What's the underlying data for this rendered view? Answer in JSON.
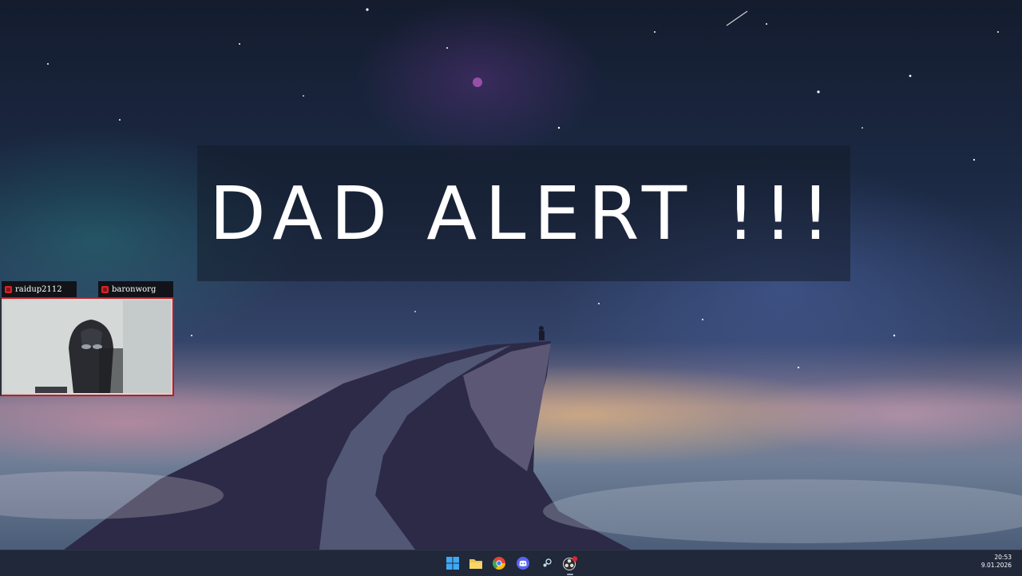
{
  "overlay": {
    "alert_text": "DAD ALERT !!!"
  },
  "chat_tags": [
    {
      "username": "raidup2112",
      "icon": "chat-user-icon"
    },
    {
      "username": "baronworg",
      "icon": "chat-user-icon"
    }
  ],
  "webcam": {
    "description_icon": "gaming-chair"
  },
  "taskbar": {
    "icons": [
      {
        "name": "windows-start-icon"
      },
      {
        "name": "file-explorer-icon"
      },
      {
        "name": "chrome-icon"
      },
      {
        "name": "discord-icon"
      },
      {
        "name": "steam-icon"
      },
      {
        "name": "obs-icon"
      }
    ],
    "clock": {
      "time": "20:53",
      "date": "9.01.2026"
    }
  },
  "colors": {
    "accent_red": "#c9171f",
    "taskbar_bg": "#20283a"
  }
}
